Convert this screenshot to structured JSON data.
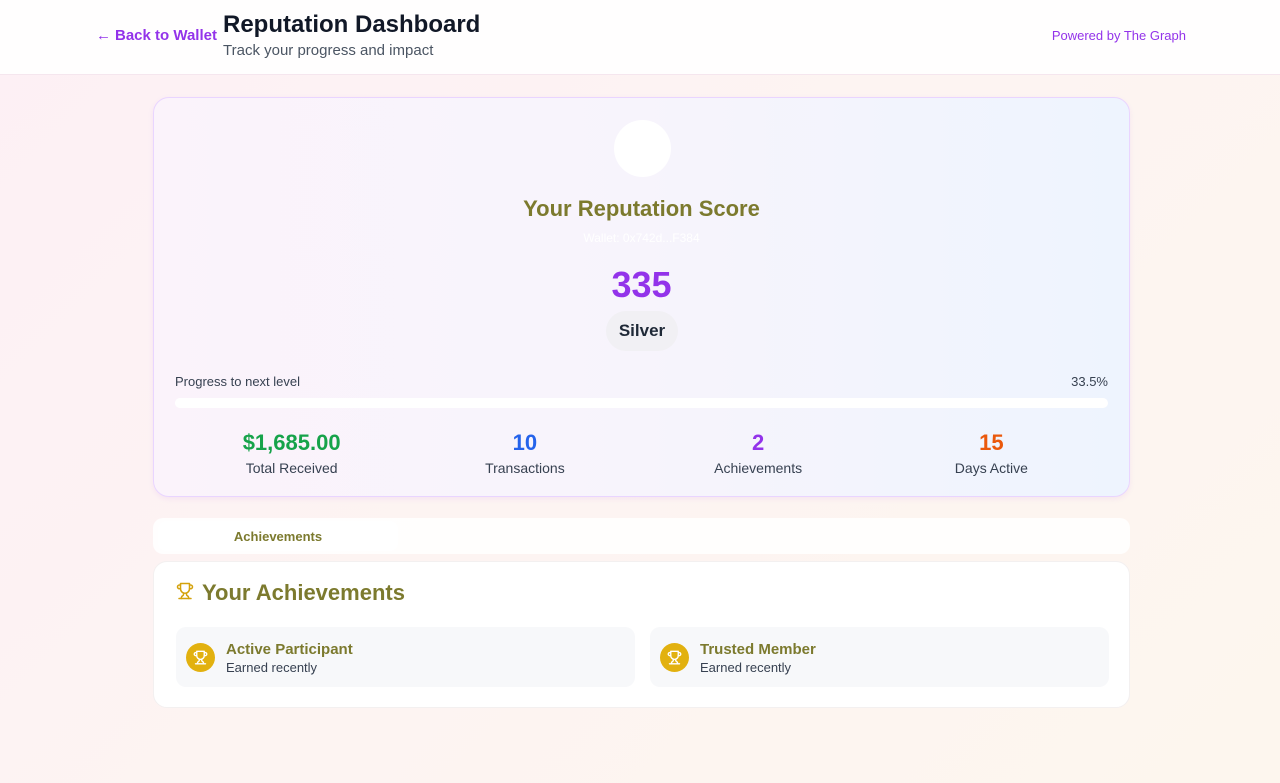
{
  "header": {
    "back_label": "Back to Wallet",
    "back_icon": "arrow-left-icon",
    "title": "Reputation Dashboard",
    "subtitle": "Track your progress and impact",
    "powered_by": "Powered by The Graph"
  },
  "score_card": {
    "heading": "Your Reputation Score",
    "wallet": "Wallet: 0x742d...F384",
    "score": "335",
    "tier": "Silver",
    "progress_label": "Progress to next level",
    "progress_percent_text": "33.5%",
    "progress_value": 0.335,
    "stats": [
      {
        "value": "$1,685.00",
        "label": "Total Received",
        "color": "#16a34a"
      },
      {
        "value": "10",
        "label": "Transactions",
        "color": "#2563eb"
      },
      {
        "value": "2",
        "label": "Achievements",
        "color": "#9333ea"
      },
      {
        "value": "15",
        "label": "Days Active",
        "color": "#ea580c"
      }
    ]
  },
  "tabs": [
    {
      "label": "Achievements",
      "active": true
    }
  ],
  "achievements": {
    "heading": "Your Achievements",
    "heading_icon": "trophy-icon",
    "items": [
      {
        "name": "Active Participant",
        "sub": "Earned recently",
        "icon": "trophy-icon"
      },
      {
        "name": "Trusted Member",
        "sub": "Earned recently",
        "icon": "trophy-icon"
      }
    ]
  },
  "colors": {
    "accent": "#9333ea",
    "olive_text": "#7c7a2e",
    "trophy_gold": "#e2b10f"
  }
}
